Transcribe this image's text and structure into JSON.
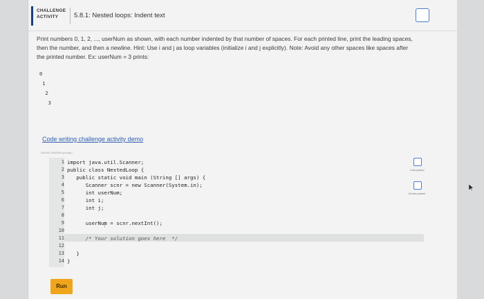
{
  "header": {
    "badge_line1": "CHALLENGE",
    "badge_line2": "ACTIVITY",
    "title": "5.8.1: Nested loops: Indent text"
  },
  "instructions": "Print numbers 0, 1, 2, ..., userNum as shown, with each number indented by that number of spaces. For each printed line, print the leading spaces, then the number, and then a newline. Hint: Use i and j as loop variables (initialize i and j explicitly). Note: Avoid any other spaces like spaces after the printed number. Ex: userNum = 3 prints:",
  "example_output": [
    "0",
    " 1",
    "  2",
    "   3"
  ],
  "demo_link": "Code writing challenge activity demo",
  "activity_id": "446160.2842840.qx3zqy7",
  "code": {
    "line_numbers": [
      "1",
      "2",
      "3",
      "4",
      "5",
      "6",
      "7",
      "8",
      "9",
      "10",
      "11",
      "12",
      "13",
      "14"
    ],
    "lines": [
      "import java.util.Scanner;",
      "public class NestedLoop {",
      "   public static void main (String [] args) {",
      "      Scanner scnr = new Scanner(System.in);",
      "      int userNum;",
      "      int i;",
      "      int j;",
      "",
      "      userNum = scnr.nextInt();",
      "",
      "      /* Your solution goes here  */",
      "",
      "   }",
      "}"
    ]
  },
  "run_label": "Run",
  "status": {
    "test1": "1 test passed",
    "test2": "All tests passed"
  },
  "colors": {
    "accent": "#1b3e7d",
    "run_button": "#f0a51c",
    "link": "#2f5fb0",
    "check_box": "#4c7dc8"
  }
}
